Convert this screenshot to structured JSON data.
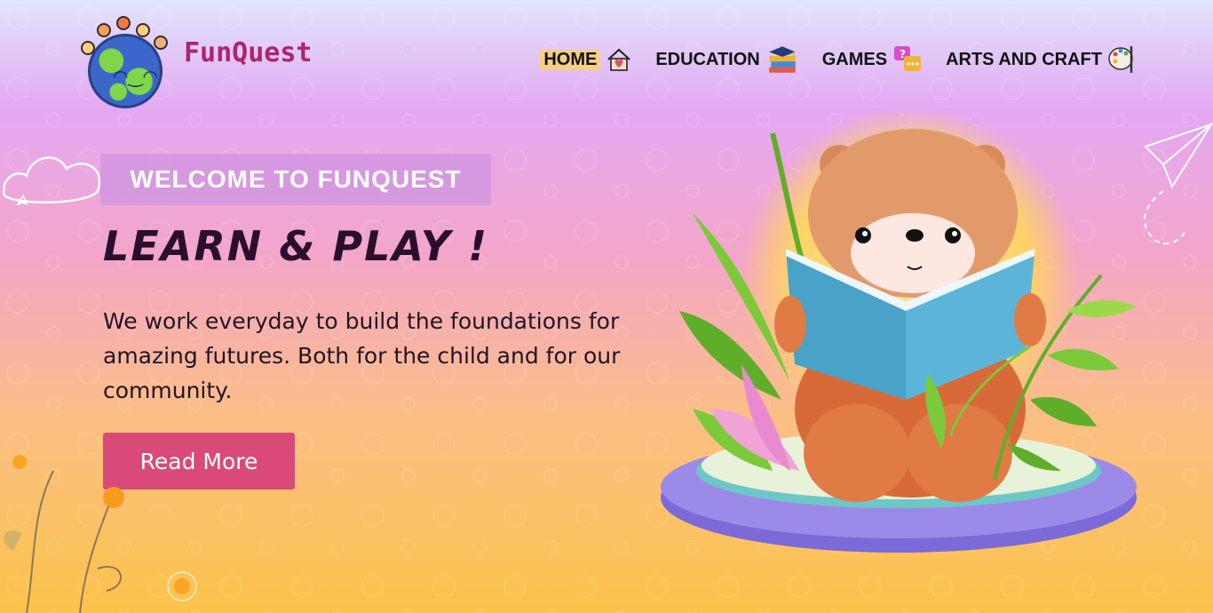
{
  "brand": {
    "name": "FunQuest",
    "logo_icon": "globe-kids-logo"
  },
  "nav": {
    "items": [
      {
        "label": "HOME",
        "icon": "house-heart-icon",
        "active": true
      },
      {
        "label": "EDUCATION",
        "icon": "books-graduation-cap-icon",
        "active": false
      },
      {
        "label": "GAMES",
        "icon": "speech-bubbles-icon",
        "active": false
      },
      {
        "label": "ARTS AND CRAFT",
        "icon": "palette-brush-icon",
        "active": false
      }
    ]
  },
  "hero": {
    "welcome": "WELCOME TO FUNQUEST",
    "headline": "LEARN & PLAY !",
    "tagline": "We work everyday to build the foundations for amazing futures. Both for the child and for our community.",
    "cta_label": "Read More",
    "illustration": "bear-reading-book",
    "decorations": [
      "paper-plane-doodle",
      "cloud-scribble",
      "flower-doodles"
    ]
  },
  "colors": {
    "brand": "#b0236a",
    "welcome_bg": "#d296e1",
    "cta_bg": "#d94a78",
    "active_nav_bg": "#f6cf84",
    "headline": "#2b0e2e"
  }
}
